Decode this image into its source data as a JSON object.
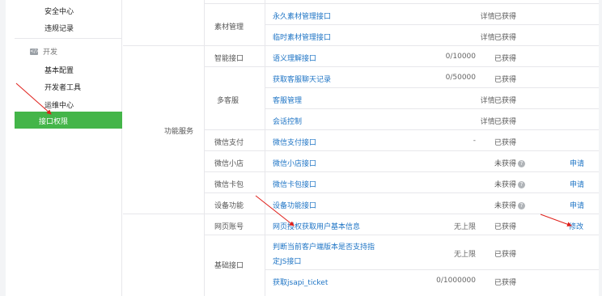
{
  "sidebar": {
    "items_top": [
      "安全中心",
      "违规记录"
    ],
    "section_title": "开发",
    "section_icon": "code-icon",
    "items_dev": [
      "基本配置",
      "开发者工具",
      "运维中心"
    ],
    "active_item": "接口权限"
  },
  "table": {
    "group_label": "功能服务",
    "categories": {
      "sucai": "素材管理",
      "zhineng": "智能接口",
      "kefu": "多客服",
      "pay": "微信支付",
      "store": "微信小店",
      "card": "微信卡包",
      "device": "设备功能",
      "web": "网页账号",
      "basic": "基础接口"
    },
    "rows": [
      {
        "api": "永久素材管理接口",
        "quota": "详情",
        "status": "已获得",
        "action": ""
      },
      {
        "api": "临时素材管理接口",
        "quota": "详情",
        "status": "已获得",
        "action": ""
      },
      {
        "api": "语义理解接口",
        "quota": "0/10000",
        "status": "已获得",
        "action": ""
      },
      {
        "api": "获取客服聊天记录",
        "quota": "0/50000",
        "status": "已获得",
        "action": ""
      },
      {
        "api": "客服管理",
        "quota": "详情",
        "status": "已获得",
        "action": ""
      },
      {
        "api": "会话控制",
        "quota": "详情",
        "status": "已获得",
        "action": ""
      },
      {
        "api": "微信支付接口",
        "quota": "-",
        "status": "已获得",
        "action": ""
      },
      {
        "api": "微信小店接口",
        "quota": "",
        "status": "未获得",
        "action": "申请"
      },
      {
        "api": "微信卡包接口",
        "quota": "",
        "status": "未获得",
        "action": "申请"
      },
      {
        "api": "设备功能接口",
        "quota": "",
        "status": "未获得",
        "action": "申请"
      },
      {
        "api": "网页授权获取用户基本信息",
        "quota": "无上限",
        "status": "已获得",
        "action": "修改"
      },
      {
        "api_line1": "判断当前客户端版本是否支持指",
        "api_line2": "定JS接口",
        "quota": "无上限",
        "status": "已获得",
        "action": ""
      },
      {
        "api": "获取jsapi_ticket",
        "quota": "0/1000000",
        "status": "已获得",
        "action": ""
      }
    ]
  },
  "colors": {
    "active_green": "#44b549",
    "link_blue": "#1e74c5",
    "arrow_red": "#e0201b"
  }
}
